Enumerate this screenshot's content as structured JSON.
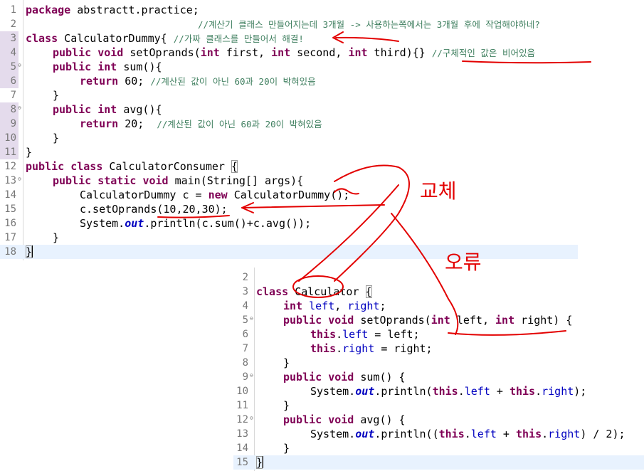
{
  "editor1": {
    "numbers": [
      "1",
      "2",
      "3",
      "4",
      "5",
      "6",
      "7",
      "8",
      "9",
      "10",
      "11",
      "12",
      "13",
      "14",
      "15",
      "16",
      "17",
      "18"
    ],
    "l1": {
      "kw": "package",
      "rest": " abstractt.practice;"
    },
    "l2": {
      "comment": "//계산기 클래스 만들어지는데 3개월 -> 사용하는쪽에서는 3개월 후에 작업해야하네?"
    },
    "l3": {
      "kw": "class",
      "name": " CalculatorDummy{ ",
      "comment": "//가짜 클래스를 만들어서 해결!"
    },
    "l4": {
      "kw1": "public",
      "kw2": "void",
      "a": " setOprands(",
      "kw3": "int",
      "b": " first, ",
      "kw4": "int",
      "c": " second, ",
      "kw5": "int",
      "d": " third){} ",
      "comment": "//구체적인 값은 비어있음"
    },
    "l5": {
      "kw1": "public",
      "kw2": "int",
      "rest": " sum(){"
    },
    "l6": {
      "kw": "return",
      "rest": " 60; ",
      "comment": "//계산된 값이 아닌 60과 20이 박혀있음"
    },
    "l7": {
      "text": "}"
    },
    "l8": {
      "kw1": "public",
      "kw2": "int",
      "rest": " avg(){"
    },
    "l9": {
      "kw": "return",
      "rest": " 20;  ",
      "comment": "//계산된 값이 아닌 60과 20이 박혀있음"
    },
    "l10": {
      "text": "}"
    },
    "l11": {
      "text": "}"
    },
    "l12": {
      "kw1": "public",
      "kw2": "class",
      "rest": " CalculatorConsumer ",
      "brace": "{"
    },
    "l13": {
      "kw1": "public",
      "kw2": "static",
      "kw3": "void",
      "rest": " main(String[] args){"
    },
    "l14": {
      "a": "CalculatorDummy c = ",
      "kw": "new",
      "b": " CalculatorDummy();"
    },
    "l15": {
      "text": "c.setOprands(10,20,30);"
    },
    "l16": {
      "a": "System.",
      "out": "out",
      "b": ".println(c.sum()+c.avg());"
    },
    "l17": {
      "text": "}"
    },
    "l18": {
      "brace": "}"
    }
  },
  "editor2": {
    "numbers": [
      "2",
      "3",
      "4",
      "5",
      "6",
      "7",
      "8",
      "9",
      "10",
      "11",
      "12",
      "13",
      "14",
      "15"
    ],
    "l3": {
      "kw": "class",
      "name": " Calculator ",
      "brace": "{"
    },
    "l4": {
      "kw": "int",
      "f1": "left",
      "sep": ", ",
      "f2": "right",
      "end": ";"
    },
    "l5": {
      "kw1": "public",
      "kw2": "void",
      "a": " setOprands(",
      "kw3": "int",
      "b": " left, ",
      "kw4": "int",
      "c": " right) {"
    },
    "l6": {
      "kw": "this",
      "dot": ".",
      "f": "left",
      "rest": " = left;"
    },
    "l7": {
      "kw": "this",
      "dot": ".",
      "f": "right",
      "rest": " = right;"
    },
    "l8": {
      "text": "}"
    },
    "l9": {
      "kw1": "public",
      "kw2": "void",
      "rest": " sum() {"
    },
    "l10": {
      "a": "System.",
      "out": "out",
      "b": ".println(",
      "kw1": "this",
      "d1": ".",
      "f1": "left",
      "p": " + ",
      "kw2": "this",
      "d2": ".",
      "f2": "right",
      "end": ");"
    },
    "l11": {
      "text": "}"
    },
    "l12": {
      "kw1": "public",
      "kw2": "void",
      "rest": " avg() {"
    },
    "l13": {
      "a": "System.",
      "out": "out",
      "b": ".println((",
      "kw1": "this",
      "d1": ".",
      "f1": "left",
      "p": " + ",
      "kw2": "this",
      "d2": ".",
      "f2": "right",
      "end": ") / 2);"
    },
    "l14": {
      "text": "}"
    },
    "l15": {
      "brace": "}"
    }
  },
  "annotations": {
    "swap_label": "교체",
    "error_label": "오류",
    "color": "#e30000"
  }
}
